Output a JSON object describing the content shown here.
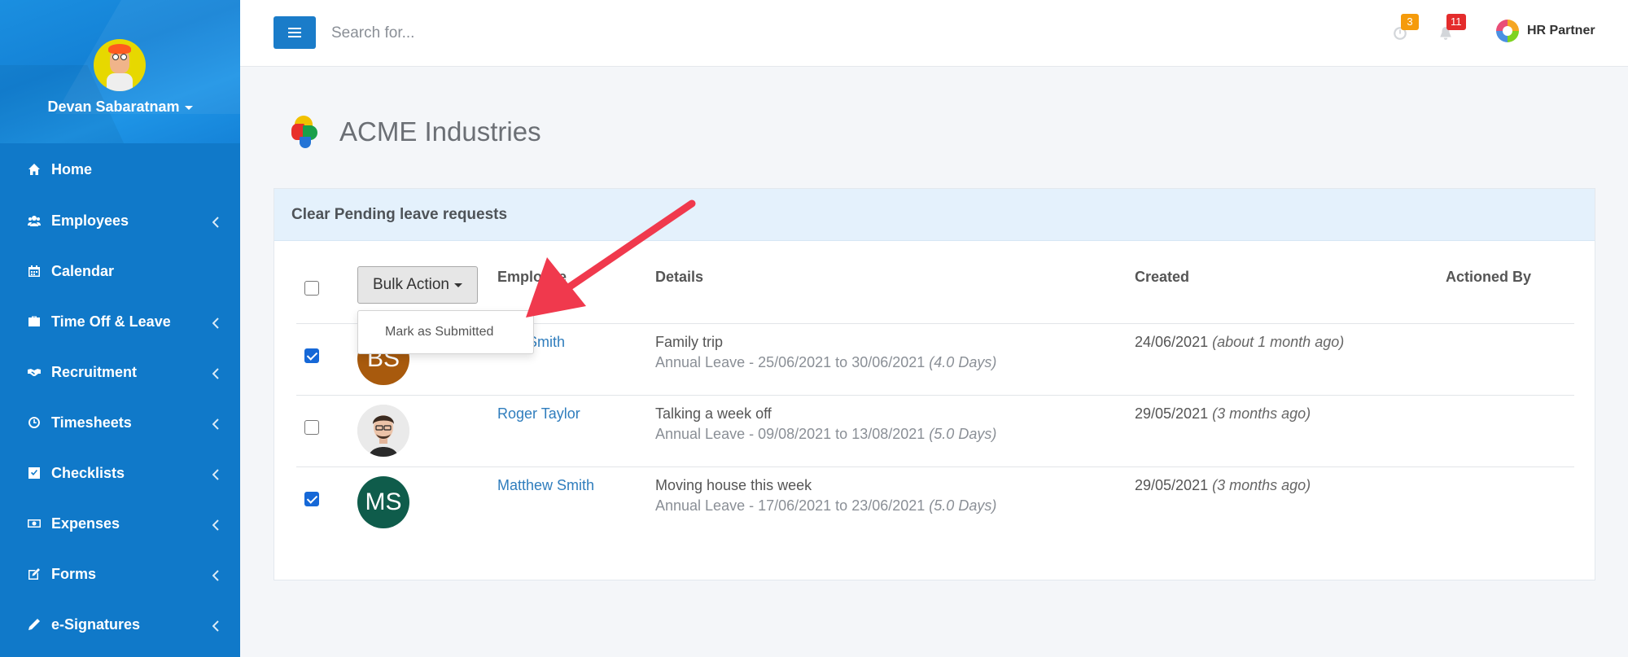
{
  "sidebar": {
    "user_name": "Devan Sabaratnam",
    "items": [
      {
        "label": "Home",
        "icon": "home-icon"
      },
      {
        "label": "Employees",
        "icon": "users-icon"
      },
      {
        "label": "Calendar",
        "icon": "calendar-icon"
      },
      {
        "label": "Time Off & Leave",
        "icon": "briefcase-icon"
      },
      {
        "label": "Recruitment",
        "icon": "handshake-icon"
      },
      {
        "label": "Timesheets",
        "icon": "clock-icon"
      },
      {
        "label": "Checklists",
        "icon": "checkbox-icon"
      },
      {
        "label": "Expenses",
        "icon": "money-icon"
      },
      {
        "label": "Forms",
        "icon": "edit-icon"
      },
      {
        "label": "e-Signatures",
        "icon": "pen-icon"
      }
    ]
  },
  "topbar": {
    "search_placeholder": "Search for...",
    "clock_badge": "3",
    "bell_badge": "11",
    "brand_name": "HR Partner"
  },
  "page": {
    "title": "ACME Industries"
  },
  "panel": {
    "title": "Clear Pending leave requests",
    "bulk_action_label": "Bulk Action",
    "dropdown_item": "Mark as Submitted",
    "headers": {
      "employee": "Employee",
      "details": "Details",
      "created": "Created",
      "actioned_by": "Actioned By"
    },
    "rows": [
      {
        "checked": true,
        "initials": "BS",
        "avatar_color": "#a85a0d",
        "name": "Ben Smith",
        "detail_title": "Family trip",
        "detail_sub": "Annual Leave - 25/06/2021 to 30/06/2021",
        "detail_days": "(4.0 Days)",
        "created_date": "24/06/2021",
        "created_ago": "(about 1 month ago)"
      },
      {
        "checked": false,
        "initials": "",
        "avatar_color": "#e6e6e6",
        "name": "Roger Taylor",
        "detail_title": "Talking a week off",
        "detail_sub": "Annual Leave - 09/08/2021 to 13/08/2021",
        "detail_days": "(5.0 Days)",
        "created_date": "29/05/2021",
        "created_ago": "(3 months ago)"
      },
      {
        "checked": true,
        "initials": "MS",
        "avatar_color": "#0f5c4b",
        "name": "Matthew Smith",
        "detail_title": "Moving house this week",
        "detail_sub": "Annual Leave - 17/06/2021 to 23/06/2021",
        "detail_days": "(5.0 Days)",
        "created_date": "29/05/2021",
        "created_ago": "(3 months ago)"
      }
    ]
  },
  "colors": {
    "sidebar": "#1079c9",
    "accent": "#1a7cc9",
    "link": "#2f7dbd",
    "arrow": "#f0394d"
  }
}
